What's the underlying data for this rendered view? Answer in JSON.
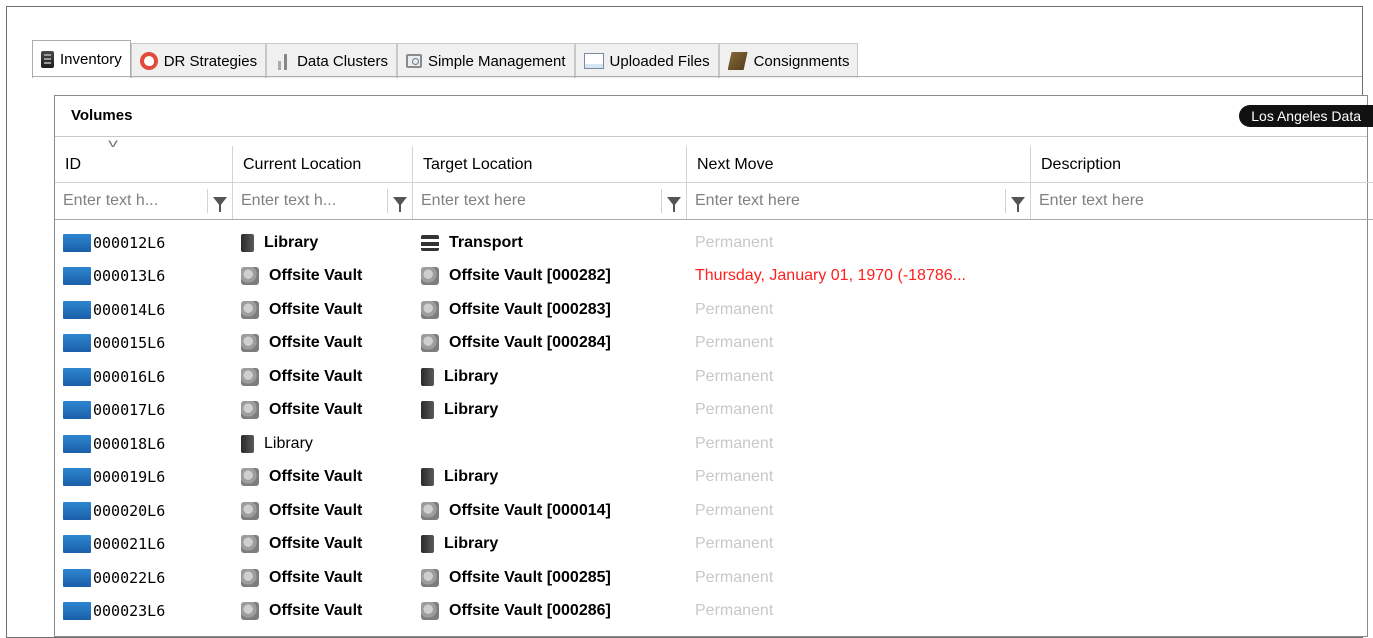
{
  "tabs": [
    {
      "label": "Inventory",
      "icon": "server-icon",
      "active": true
    },
    {
      "label": "DR Strategies",
      "icon": "life-ring-icon",
      "active": false
    },
    {
      "label": "Data Clusters",
      "icon": "cluster-icon",
      "active": false
    },
    {
      "label": "Simple Management",
      "icon": "monitor-icon",
      "active": false
    },
    {
      "label": "Uploaded Files",
      "icon": "document-icon",
      "active": false
    },
    {
      "label": "Consignments",
      "icon": "box-icon",
      "active": false
    }
  ],
  "panel": {
    "title": "Volumes",
    "site_badge": "Los Angeles Data"
  },
  "columns": {
    "id": "ID",
    "current_location": "Current Location",
    "target_location": "Target Location",
    "next_move": "Next Move",
    "description": "Description"
  },
  "filters": {
    "id_placeholder": "Enter text h...",
    "current_placeholder": "Enter text h...",
    "target_placeholder": "Enter text here",
    "next_placeholder": "Enter text here",
    "description_placeholder": "Enter text here"
  },
  "rows": [
    {
      "id": "000012L6",
      "current": "Library",
      "current_icon": "library-icon",
      "target": "Transport",
      "target_icon": "truck-icon",
      "next": "Permanent"
    },
    {
      "id": "000013L6",
      "current": "Offsite Vault",
      "current_icon": "vault-icon",
      "target": "Offsite Vault [000282]",
      "target_icon": "vault-icon",
      "next": "Thursday, January 01, 1970 (-18786..."
    },
    {
      "id": "000014L6",
      "current": "Offsite Vault",
      "current_icon": "vault-icon",
      "target": "Offsite Vault [000283]",
      "target_icon": "vault-icon",
      "next": "Permanent"
    },
    {
      "id": "000015L6",
      "current": "Offsite Vault",
      "current_icon": "vault-icon",
      "target": "Offsite Vault [000284]",
      "target_icon": "vault-icon",
      "next": "Permanent"
    },
    {
      "id": "000016L6",
      "current": "Offsite Vault",
      "current_icon": "vault-icon",
      "target": "Library",
      "target_icon": "library-icon",
      "next": "Permanent"
    },
    {
      "id": "000017L6",
      "current": "Offsite Vault",
      "current_icon": "vault-icon",
      "target": "Library",
      "target_icon": "library-icon",
      "next": "Permanent"
    },
    {
      "id": "000018L6",
      "current": "Library",
      "current_icon": "library-icon",
      "target": "",
      "target_icon": "",
      "next": "Permanent"
    },
    {
      "id": "000019L6",
      "current": "Offsite Vault",
      "current_icon": "vault-icon",
      "target": "Library",
      "target_icon": "library-icon",
      "next": "Permanent"
    },
    {
      "id": "000020L6",
      "current": "Offsite Vault",
      "current_icon": "vault-icon",
      "target": "Offsite Vault [000014]",
      "target_icon": "vault-icon",
      "next": "Permanent"
    },
    {
      "id": "000021L6",
      "current": "Offsite Vault",
      "current_icon": "vault-icon",
      "target": "Library",
      "target_icon": "library-icon",
      "next": "Permanent"
    },
    {
      "id": "000022L6",
      "current": "Offsite Vault",
      "current_icon": "vault-icon",
      "target": "Offsite Vault [000285]",
      "target_icon": "vault-icon",
      "next": "Permanent"
    },
    {
      "id": "000023L6",
      "current": "Offsite Vault",
      "current_icon": "vault-icon",
      "target": "Offsite Vault [000286]",
      "target_icon": "vault-icon",
      "next": "Permanent"
    }
  ],
  "colors": {
    "tape": "#2e86d0",
    "overdue": "#ff2020",
    "muted": "#c8c8c8"
  }
}
